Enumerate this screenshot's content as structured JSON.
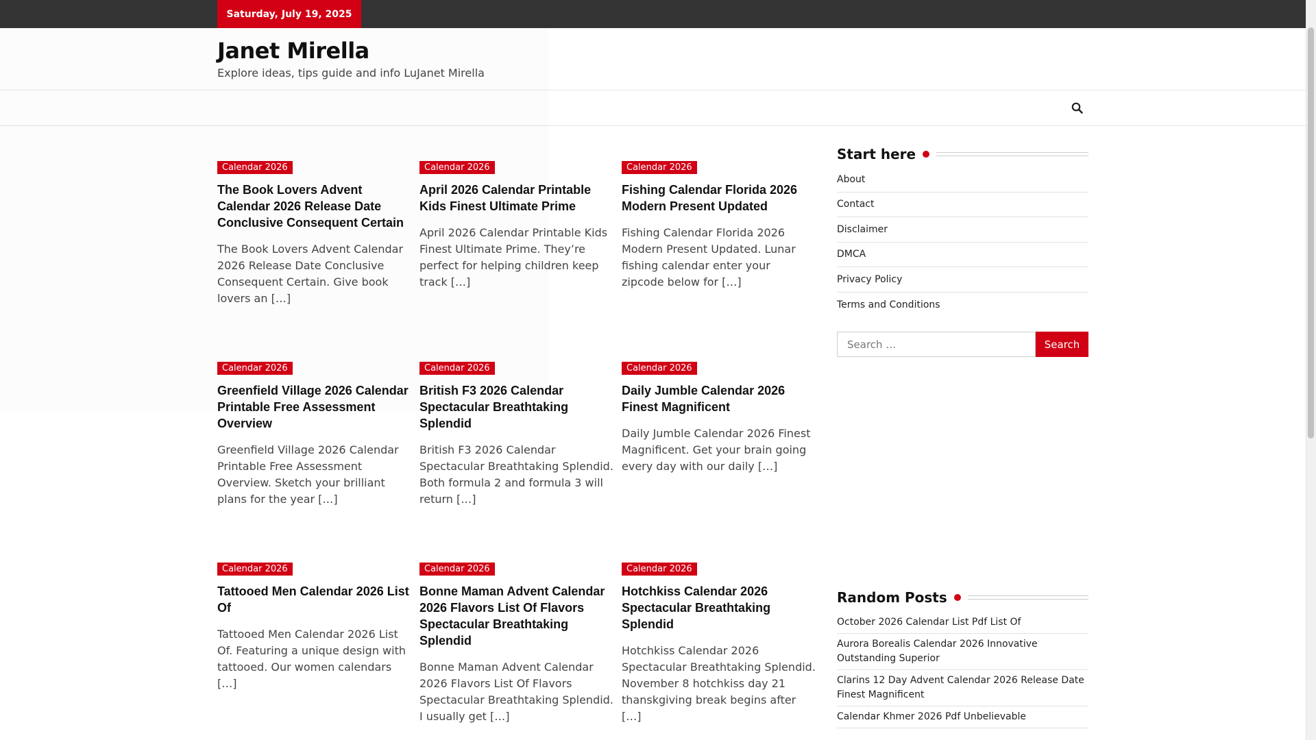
{
  "topbar": {
    "date": "Saturday, July 19, 2025"
  },
  "header": {
    "site_title": "Janet Mirella",
    "site_description": "Explore ideas, tips guide and info LuJanet Mirella"
  },
  "nav": {
    "search_icon": "search-icon"
  },
  "posts": [
    {
      "category": "Calendar 2026",
      "title": "The Book Lovers Advent Calendar 2026 Release Date Conclusive Consequent Certain",
      "excerpt": "The Book Lovers Advent Calendar 2026 Release Date Conclusive Consequent Certain. Give book lovers an […]"
    },
    {
      "category": "Calendar 2026",
      "title": "April 2026 Calendar Printable Kids Finest Ultimate Prime",
      "excerpt": "April 2026 Calendar Printable Kids Finest Ultimate Prime. They’re perfect for helping children keep track […]"
    },
    {
      "category": "Calendar 2026",
      "title": "Fishing Calendar Florida 2026 Modern Present Updated",
      "excerpt": "Fishing Calendar Florida 2026 Modern Present Updated. Lunar fishing calendar enter your zipcode below for […]"
    },
    {
      "category": "Calendar 2026",
      "title": "Greenfield Village 2026 Calendar Printable Free Assessment Overview",
      "excerpt": "Greenfield Village 2026 Calendar Printable Free Assessment Overview. Sketch your brilliant plans for the year […]"
    },
    {
      "category": "Calendar 2026",
      "title": "British F3 2026 Calendar Spectacular Breathtaking Splendid",
      "excerpt": "British F3 2026 Calendar Spectacular Breathtaking Splendid. Both formula 2 and formula 3 will return […]"
    },
    {
      "category": "Calendar 2026",
      "title": "Daily Jumble Calendar 2026 Finest Magnificent",
      "excerpt": "Daily Jumble Calendar 2026 Finest Magnificent. Get your brain going every day with our daily […]"
    },
    {
      "category": "Calendar 2026",
      "title": "Tattooed Men Calendar 2026 List Of",
      "excerpt": "Tattooed Men Calendar 2026 List Of. Featuring a unique design with tattooed. Our women calendars […]"
    },
    {
      "category": "Calendar 2026",
      "title": "Bonne Maman Advent Calendar 2026 Flavors List Of Flavors Spectacular Breathtaking Splendid",
      "excerpt": "Bonne Maman Advent Calendar 2026 Flavors List Of Flavors Spectacular Breathtaking Splendid. I usually get […]"
    },
    {
      "category": "Calendar 2026",
      "title": "Hotchkiss Calendar 2026 Spectacular Breathtaking Splendid",
      "excerpt": "Hotchkiss Calendar 2026 Spectacular Breathtaking Splendid. November 8 hotchkiss day 21 thanskgiving break begins after […]"
    }
  ],
  "sidebar": {
    "start_title": "Start here",
    "pages": [
      "About",
      "Contact",
      "Disclaimer",
      "DMCA",
      "Privacy Policy",
      "Terms and Conditions"
    ],
    "search": {
      "placeholder": "Search …",
      "button": "Search"
    },
    "random_title": "Random Posts",
    "random_posts": [
      "October 2026 Calendar List Pdf List Of",
      "Aurora Borealis Calendar 2026 Innovative Outstanding Superior",
      "Clarins 12 Day Advent Calendar 2026 Release Date Finest Magnificent",
      "Calendar Khmer 2026 Pdf Unbelievable"
    ]
  },
  "colors": {
    "accent": "#d10014",
    "topbar": "#333333"
  }
}
